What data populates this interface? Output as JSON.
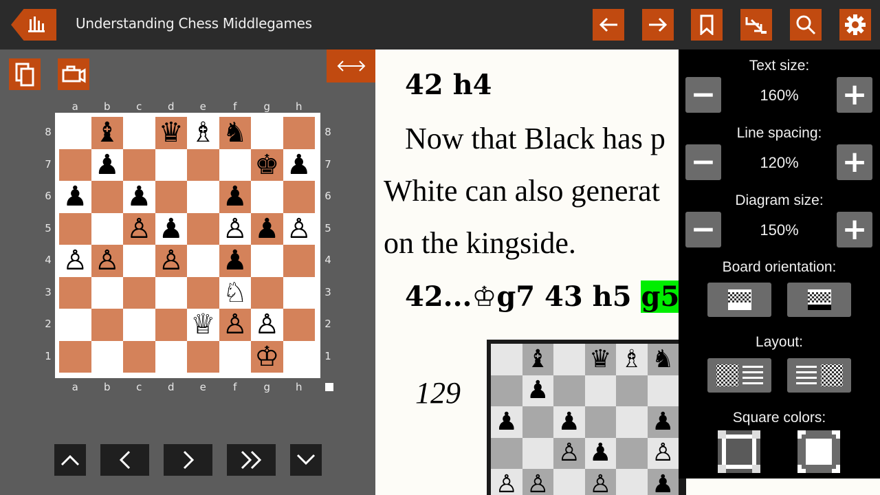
{
  "header": {
    "title": "Understanding Chess Middlegames",
    "buttons": [
      "back-arrow",
      "forward-arrow",
      "bookmark",
      "goto-move",
      "search",
      "settings"
    ]
  },
  "board_labels": {
    "files": [
      "a",
      "b",
      "c",
      "d",
      "e",
      "f",
      "g",
      "h"
    ],
    "ranks": [
      "8",
      "7",
      "6",
      "5",
      "4",
      "3",
      "2",
      "1"
    ]
  },
  "board": {
    "light_color": "#ffffff",
    "dark_color": "#d4825a",
    "rows": [
      [
        "",
        "♝",
        "",
        "♛",
        "♗",
        "♞",
        "",
        ""
      ],
      [
        "",
        "♟",
        "",
        "",
        "",
        "",
        "♚",
        "♟"
      ],
      [
        "♟",
        "",
        "♟",
        "",
        "",
        "♟",
        "",
        ""
      ],
      [
        "",
        "",
        "♙",
        "♟",
        "",
        "♙",
        "♟",
        "♙"
      ],
      [
        "♙",
        "♙",
        "",
        "♙",
        "",
        "♟",
        "",
        ""
      ],
      [
        "",
        "",
        "",
        "",
        "",
        "♘",
        "",
        ""
      ],
      [
        "",
        "",
        "",
        "",
        "♕",
        "♙",
        "♙",
        ""
      ],
      [
        "",
        "",
        "",
        "",
        "",
        "",
        "♔",
        ""
      ]
    ]
  },
  "text": {
    "move1": "42 h4",
    "para_line1": "Now that Black has p",
    "para_line2": "White can also generat",
    "para_line3": "on the kingside.",
    "move2_prefix": "42...",
    "move2_king": "♔",
    "move2_mid": "g7 43 h5 ",
    "move2_highlight": "g5",
    "diagram_number": "129"
  },
  "diagram2": {
    "light_color": "#e6e6e6",
    "dark_color": "#a8a8a8",
    "rows": [
      [
        "",
        "♝",
        "",
        "♛",
        "♗",
        "♞"
      ],
      [
        "",
        "♟",
        "",
        "",
        "",
        ""
      ],
      [
        "♟",
        "",
        "♟",
        "",
        "",
        "♟"
      ],
      [
        "",
        "",
        "♙",
        "♟",
        "",
        "♙"
      ],
      [
        "♙",
        "♙",
        "",
        "♙",
        "",
        "♟"
      ]
    ]
  },
  "settings": {
    "text_size_label": "Text size:",
    "text_size_value": "160%",
    "line_spacing_label": "Line spacing:",
    "line_spacing_value": "120%",
    "diagram_size_label": "Diagram size:",
    "diagram_size_value": "150%",
    "orientation_label": "Board orientation:",
    "layout_label": "Layout:",
    "colors_label": "Square colors:",
    "minus": "−",
    "plus": "+"
  },
  "colors": {
    "accent": "#c14a10",
    "highlight": "#00ee00"
  }
}
